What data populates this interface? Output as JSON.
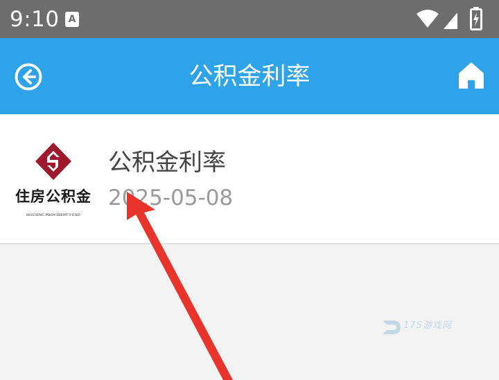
{
  "status_bar": {
    "time": "9:10",
    "notification_icon_letter": "A",
    "icons": [
      "wifi-icon",
      "signal-icon",
      "battery-charging-icon"
    ]
  },
  "header": {
    "title": "公积金利率",
    "back_icon": "back-arrow-circle-icon",
    "home_icon": "home-icon",
    "background_color": "#2ea3ea"
  },
  "list": {
    "items": [
      {
        "logo": {
          "cn_text": "住房公积金",
          "en_text": "HOUSING PROVIDENT FUND",
          "mark_color": "#a0182e"
        },
        "title": "公积金利率",
        "date": "2025-05-08"
      }
    ]
  },
  "annotation": {
    "type": "red-arrow",
    "color": "#e8342a"
  },
  "watermark": {
    "text": "175游戏网"
  }
}
